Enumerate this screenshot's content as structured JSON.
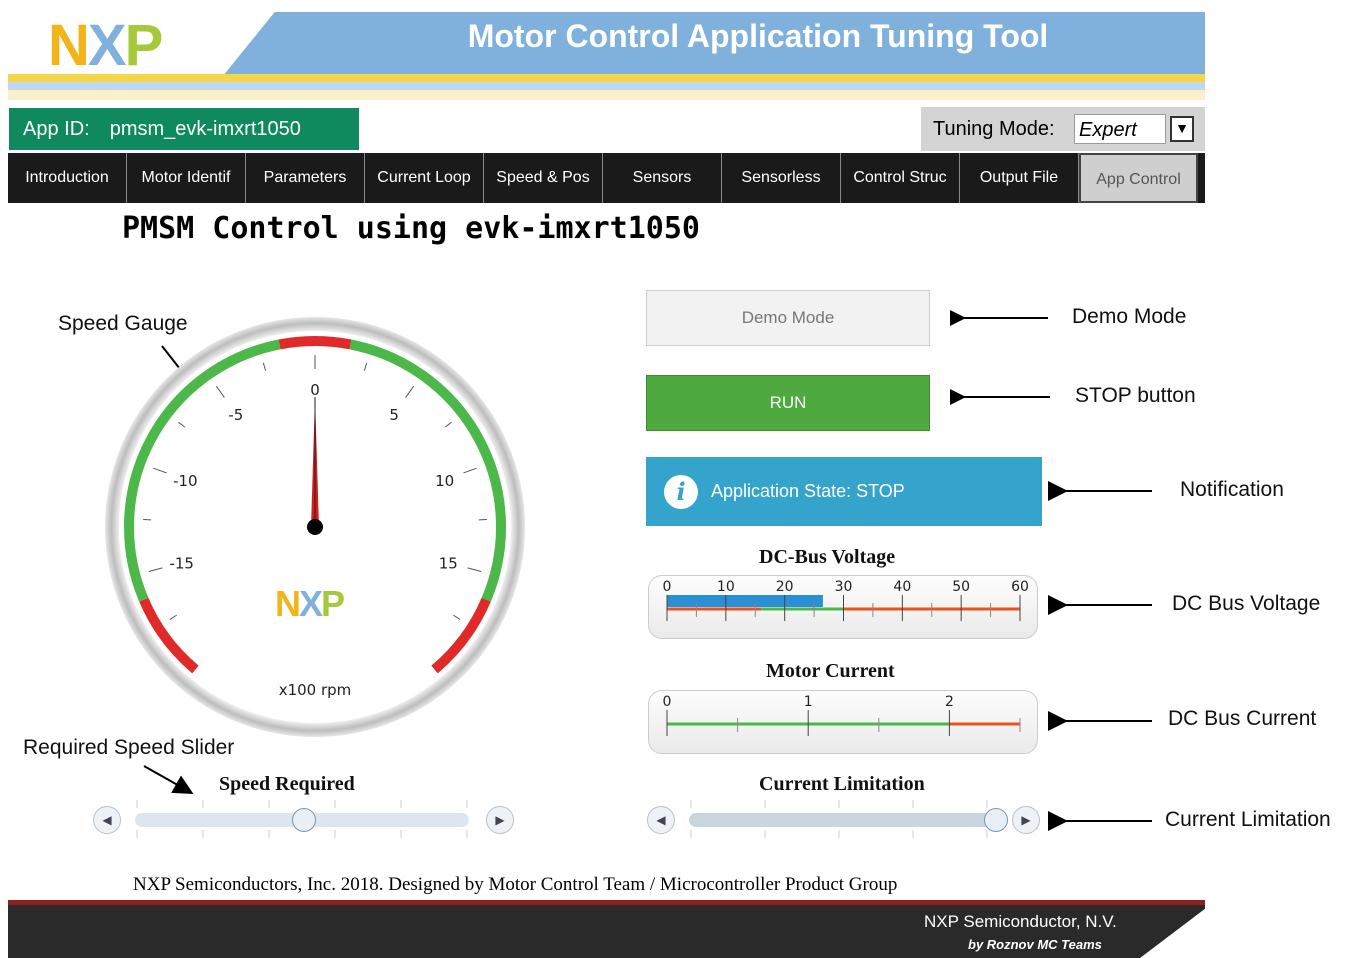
{
  "header": {
    "title": "Motor Control Application Tuning Tool",
    "logo": {
      "n": "N",
      "x": "X",
      "p": "P"
    }
  },
  "app_id": {
    "label": "App ID:",
    "value": "pmsm_evk-imxrt1050"
  },
  "tuning_mode": {
    "label": "Tuning Mode:",
    "selected": "Expert"
  },
  "tabs": [
    {
      "label": "Introduction"
    },
    {
      "label": "Motor Identif"
    },
    {
      "label": "Parameters"
    },
    {
      "label": "Current Loop"
    },
    {
      "label": "Speed & Pos"
    },
    {
      "label": "Sensors"
    },
    {
      "label": "Sensorless"
    },
    {
      "label": "Control Struc"
    },
    {
      "label": "Output File"
    },
    {
      "label": "App Control"
    }
  ],
  "page_title": "PMSM Control using evk-imxrt1050",
  "speed_gauge": {
    "annotation": "Speed Gauge",
    "min": -20,
    "max": 20,
    "value": 0,
    "labels": [
      "-15",
      "-10",
      "-5",
      "0",
      "5",
      "10",
      "15"
    ],
    "unit": "x100 rpm",
    "logo": {
      "n": "N",
      "x": "X",
      "p": "P"
    }
  },
  "speed_slider": {
    "annotation": "Required Speed Slider",
    "title": "Speed Required",
    "value_fraction": 0.5,
    "left_icon": "chevron-left-icon",
    "right_icon": "chevron-right-icon"
  },
  "demo_mode": {
    "label": "Demo Mode",
    "annotation": "Demo Mode"
  },
  "run_button": {
    "label": "RUN",
    "annotation": "STOP button"
  },
  "notification": {
    "icon": "info-icon",
    "icon_glyph": "i",
    "text": "Application State: STOP",
    "annotation": "Notification"
  },
  "dc_bus_voltage": {
    "title": "DC-Bus Voltage",
    "annotation": "DC Bus Voltage",
    "min": 0,
    "max": 60,
    "tick_labels": [
      "0",
      "10",
      "20",
      "30",
      "40",
      "50",
      "60"
    ],
    "value": 26.5
  },
  "motor_current": {
    "title": "Motor Current",
    "annotation": "DC Bus Current",
    "min": 0,
    "max": 2.5,
    "tick_labels": [
      "0",
      "1",
      "2"
    ]
  },
  "current_limitation": {
    "title": "Current Limitation",
    "annotation": "Current Limitation",
    "value_fraction": 0.97
  },
  "footer": {
    "text": "NXP Semiconductors, Inc. 2018. Designed by Motor Control Team / Microcontroller Product Group",
    "company": "NXP Semiconductor, N.V.",
    "by": "by Roznov MC Teams"
  }
}
